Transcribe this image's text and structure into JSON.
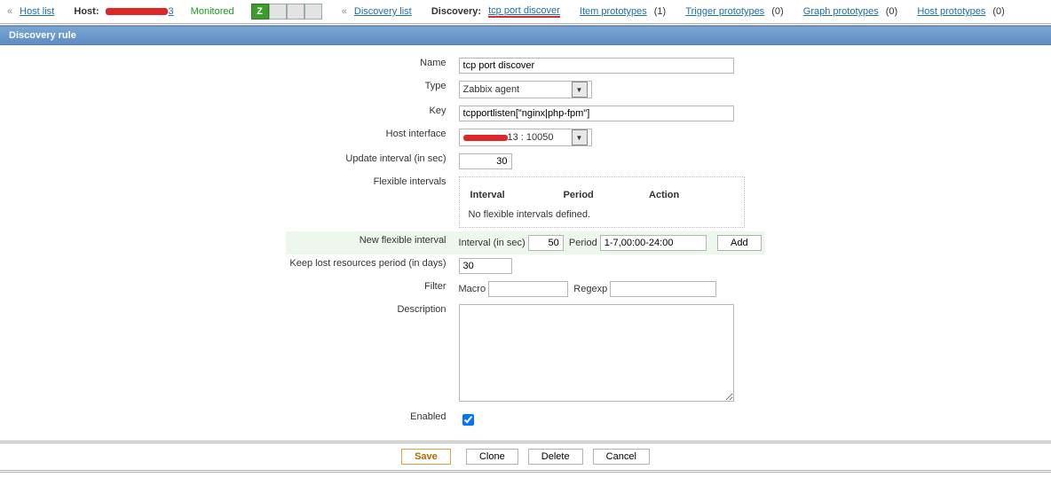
{
  "top": {
    "host_list_link": "Host list",
    "host_label": "Host:",
    "host_value_suffix": "3",
    "monitored": "Monitored",
    "discovery_list_link": "Discovery list",
    "discovery_label": "Discovery:",
    "discovery_link": "tcp port discover",
    "item_prototypes": {
      "label": "Item prototypes",
      "count": "(1)"
    },
    "trigger_prototypes": {
      "label": "Trigger prototypes",
      "count": "(0)"
    },
    "graph_prototypes": {
      "label": "Graph prototypes",
      "count": "(0)"
    },
    "host_prototypes": {
      "label": "Host prototypes",
      "count": "(0)"
    },
    "z_glyph": "Z"
  },
  "header": {
    "title": "Discovery rule"
  },
  "form": {
    "name_label": "Name",
    "name_value": "tcp port discover",
    "type_label": "Type",
    "type_value": "Zabbix agent",
    "key_label": "Key",
    "key_value": "tcpportlisten[\"nginx|php-fpm\"]",
    "host_interface_label": "Host interface",
    "host_interface_value_suffix": "13 : 10050",
    "update_interval_label": "Update interval (in sec)",
    "update_interval_value": "30",
    "flexible_intervals_label": "Flexible intervals",
    "flex_head_interval": "Interval",
    "flex_head_period": "Period",
    "flex_head_action": "Action",
    "flex_empty": "No flexible intervals defined.",
    "new_flex_label": "New flexible interval",
    "new_flex_interval_label": "Interval (in sec)",
    "new_flex_interval_value": "50",
    "new_flex_period_label": "Period",
    "new_flex_period_value": "1-7,00:00-24:00",
    "new_flex_add": "Add",
    "keep_lost_label": "Keep lost resources period (in days)",
    "keep_lost_value": "30",
    "filter_label": "Filter",
    "filter_macro_label": "Macro",
    "filter_regexp_label": "Regexp",
    "description_label": "Description",
    "description_value": "",
    "enabled_label": "Enabled"
  },
  "footer": {
    "save": "Save",
    "clone": "Clone",
    "delete": "Delete",
    "cancel": "Cancel"
  }
}
